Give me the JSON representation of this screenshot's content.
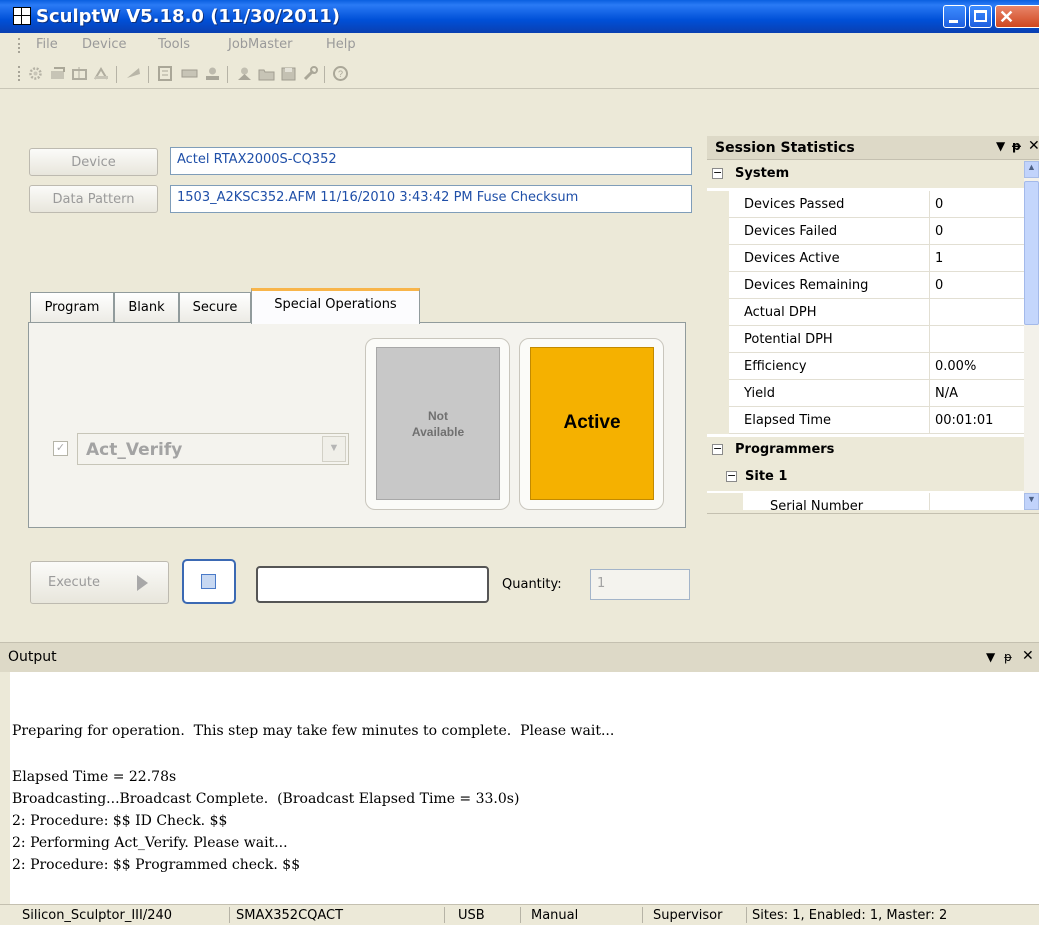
{
  "window": {
    "title": "SculptW  V5.18.0 (11/30/2011)"
  },
  "menu": [
    "File",
    "Device",
    "Tools",
    "JobMaster",
    "Help"
  ],
  "device": {
    "button_label": "Device",
    "value": "Actel RTAX2000S-CQ352"
  },
  "data_pattern": {
    "button_label": "Data Pattern",
    "value": "1503_A2KSC352.AFM    11/16/2010 3:43:42 PM    Fuse Checksum"
  },
  "tabs": [
    "Program",
    "Blank",
    "Secure",
    "Special Operations"
  ],
  "active_tab": "Special Operations",
  "special_ops": {
    "operation_checked": true,
    "operation": "Act_Verify",
    "status_not_available": "Not Available",
    "status_active": "Active",
    "active_color": "#f5b100"
  },
  "execute": {
    "label": "Execute",
    "quantity_label": "Quantity:",
    "quantity_value": "1",
    "progress_text": ""
  },
  "session_stats": {
    "title": "Session Statistics",
    "system_label": "System",
    "rows": [
      {
        "name": "Devices Passed",
        "value": "0"
      },
      {
        "name": "Devices Failed",
        "value": "0"
      },
      {
        "name": "Devices Active",
        "value": "1"
      },
      {
        "name": "Devices Remaining",
        "value": "0"
      },
      {
        "name": "Actual DPH",
        "value": ""
      },
      {
        "name": "Potential DPH",
        "value": ""
      },
      {
        "name": "Efficiency",
        "value": "0.00%"
      },
      {
        "name": "Yield",
        "value": "N/A"
      },
      {
        "name": "Elapsed Time",
        "value": "00:01:01"
      }
    ],
    "programmers_label": "Programmers",
    "site_label": "Site 1",
    "site_rows": [
      {
        "name": "Serial Number",
        "value": ""
      }
    ]
  },
  "output": {
    "title": "Output",
    "lines": [
      "Preparing for operation.  This step may take few minutes to complete.  Please wait...",
      "Elapsed Time = 22.78s",
      "Broadcasting...Broadcast Complete.  (Broadcast Elapsed Time = 33.0s)",
      "2: Procedure: $$ ID Check. $$",
      "2: Performing Act_Verify. Please wait...",
      "2: Procedure: $$ Programmed check. $$"
    ]
  },
  "statusbar": {
    "programmer": "Silicon_Sculptor_III/240",
    "adapter": "SMAX352CQACT",
    "connection": "USB",
    "mode": "Manual",
    "user": "Supervisor",
    "sites": "Sites: 1, Enabled: 1, Master: 2"
  }
}
